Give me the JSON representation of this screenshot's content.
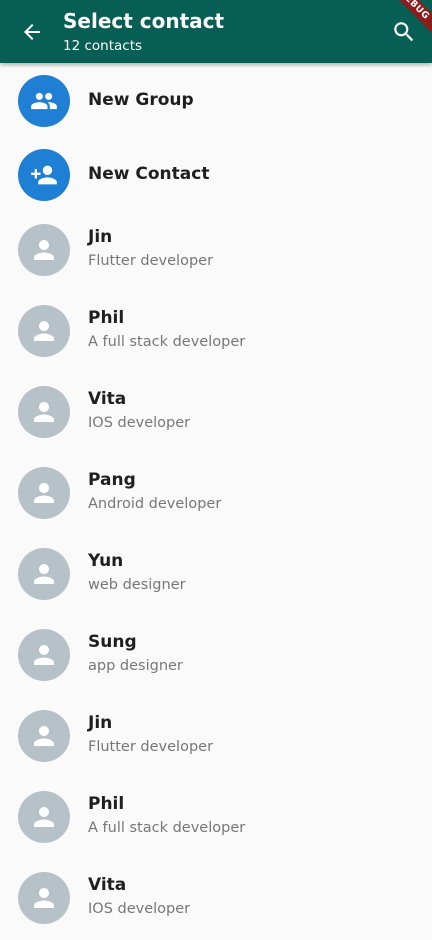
{
  "appbar": {
    "title": "Select contact",
    "subtitle": "12 contacts",
    "debug_label": "DEBUG",
    "back_icon": "arrow-back-icon",
    "search_icon": "search-icon",
    "color": "#075e54"
  },
  "actions": [
    {
      "label": "New Group",
      "icon": "group-icon",
      "color": "#1e7fd4"
    },
    {
      "label": "New Contact",
      "icon": "person-add-icon",
      "color": "#1e7fd4"
    }
  ],
  "contacts": [
    {
      "name": "Jin",
      "status": "Flutter developer"
    },
    {
      "name": "Phil",
      "status": "A full stack developer"
    },
    {
      "name": "Vita",
      "status": "IOS developer"
    },
    {
      "name": "Pang",
      "status": "Android developer"
    },
    {
      "name": "Yun",
      "status": "web designer"
    },
    {
      "name": "Sung",
      "status": "app designer"
    },
    {
      "name": "Jin",
      "status": "Flutter developer"
    },
    {
      "name": "Phil",
      "status": "A full stack developer"
    },
    {
      "name": "Vita",
      "status": "IOS developer"
    }
  ],
  "avatar_color": "#b6c2c7"
}
